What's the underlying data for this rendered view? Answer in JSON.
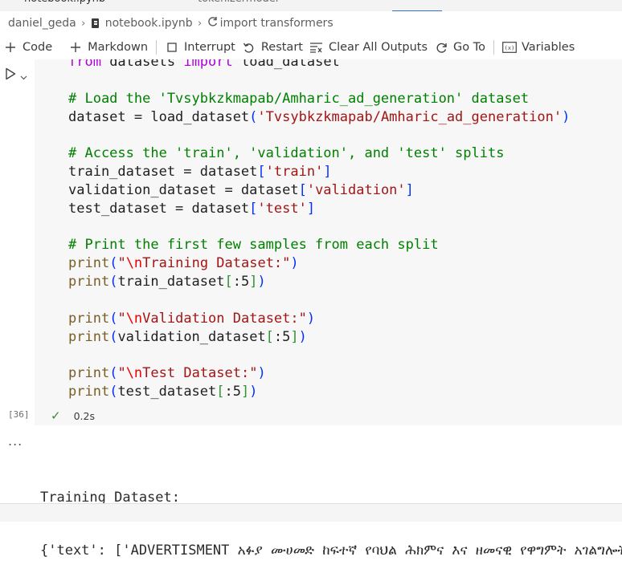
{
  "tabs": [
    {
      "label": "notebook.ipynb",
      "active": true
    },
    {
      "label": "tokenizermodel",
      "active": false
    }
  ],
  "breadcrumb": {
    "folder": "daniel_geda",
    "file": "notebook.ipynb",
    "cell": "import transformers"
  },
  "toolbar": {
    "code": "Code",
    "markdown": "Markdown",
    "interrupt": "Interrupt",
    "restart": "Restart",
    "clear_outputs": "Clear All Outputs",
    "go_to": "Go To",
    "variables": "Variables"
  },
  "cell": {
    "execution_count": "[36]",
    "duration": "0.2s",
    "code_lines": [
      [
        {
          "t": "from",
          "c": "kw"
        },
        {
          "t": " datasets "
        },
        {
          "t": "import",
          "c": "kw"
        },
        {
          "t": " load_dataset"
        }
      ],
      [],
      [
        {
          "t": "# Load the 'Tvsybkzkmapab/Amharic_ad_generation' dataset",
          "c": "cm"
        }
      ],
      [
        {
          "t": "dataset = load_dataset"
        },
        {
          "t": "(",
          "c": "bp"
        },
        {
          "t": "'Tvsybkzkmapab/Amharic_ad_generation'",
          "c": "st"
        },
        {
          "t": ")",
          "c": "bp"
        }
      ],
      [],
      [
        {
          "t": "# Access the 'train', 'validation', and 'test' splits",
          "c": "cm"
        }
      ],
      [
        {
          "t": "train_dataset = dataset"
        },
        {
          "t": "[",
          "c": "bp"
        },
        {
          "t": "'train'",
          "c": "st"
        },
        {
          "t": "]",
          "c": "bp"
        }
      ],
      [
        {
          "t": "validation_dataset = dataset"
        },
        {
          "t": "[",
          "c": "bp"
        },
        {
          "t": "'validation'",
          "c": "st"
        },
        {
          "t": "]",
          "c": "bp"
        }
      ],
      [
        {
          "t": "test_dataset = dataset"
        },
        {
          "t": "[",
          "c": "bp"
        },
        {
          "t": "'test'",
          "c": "st"
        },
        {
          "t": "]",
          "c": "bp"
        }
      ],
      [],
      [
        {
          "t": "# Print the first few samples from each split",
          "c": "cm"
        }
      ],
      [
        {
          "t": "print",
          "c": "fn"
        },
        {
          "t": "(",
          "c": "bp"
        },
        {
          "t": "\"",
          "c": "st"
        },
        {
          "t": "\\n",
          "c": "esc"
        },
        {
          "t": "Training Dataset:\"",
          "c": "st"
        },
        {
          "t": ")",
          "c": "bp"
        }
      ],
      [
        {
          "t": "print",
          "c": "fn"
        },
        {
          "t": "(",
          "c": "bp"
        },
        {
          "t": "train_dataset"
        },
        {
          "t": "[",
          "c": "bk"
        },
        {
          "t": ":5"
        },
        {
          "t": "]",
          "c": "bk"
        },
        {
          "t": ")",
          "c": "bp"
        }
      ],
      [],
      [
        {
          "t": "print",
          "c": "fn"
        },
        {
          "t": "(",
          "c": "bp"
        },
        {
          "t": "\"",
          "c": "st"
        },
        {
          "t": "\\n",
          "c": "esc"
        },
        {
          "t": "Validation Dataset:\"",
          "c": "st"
        },
        {
          "t": ")",
          "c": "bp"
        }
      ],
      [
        {
          "t": "print",
          "c": "fn"
        },
        {
          "t": "(",
          "c": "bp"
        },
        {
          "t": "validation_dataset"
        },
        {
          "t": "[",
          "c": "bk"
        },
        {
          "t": ":5"
        },
        {
          "t": "]",
          "c": "bk"
        },
        {
          "t": ")",
          "c": "bp"
        }
      ],
      [],
      [
        {
          "t": "print",
          "c": "fn"
        },
        {
          "t": "(",
          "c": "bp"
        },
        {
          "t": "\"",
          "c": "st"
        },
        {
          "t": "\\n",
          "c": "esc"
        },
        {
          "t": "Test Dataset:\"",
          "c": "st"
        },
        {
          "t": ")",
          "c": "bp"
        }
      ],
      [
        {
          "t": "print",
          "c": "fn"
        },
        {
          "t": "(",
          "c": "bp"
        },
        {
          "t": "test_dataset"
        },
        {
          "t": "[",
          "c": "bk"
        },
        {
          "t": ":5"
        },
        {
          "t": "]",
          "c": "bk"
        },
        {
          "t": ")",
          "c": "bp"
        }
      ]
    ]
  },
  "output": {
    "more": "...",
    "lines": [
      "Training Dataset:",
      "{'text': ['ADVERTISMENT አፉያ ሙሀመድ ከፍተኛ የባህል ሕክምና እና ዘመናዊ የዋግምት አገልግሎት"
    ]
  },
  "colors": {
    "keyword": "#af00db",
    "comment": "#008000",
    "string": "#a31515",
    "function": "#795e26",
    "bracket": "#0431fa",
    "success": "#388a34",
    "accent": "#2d6fd2"
  }
}
